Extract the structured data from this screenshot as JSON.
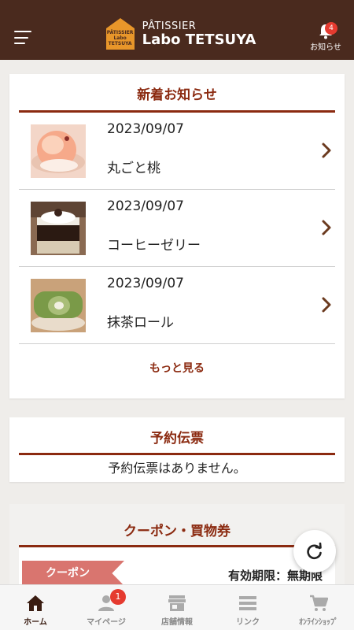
{
  "header": {
    "brand_small": "PÂTISSIER",
    "brand_main": "Labo TETSUYA",
    "logo_text": "PÂTISSIER Labo TETSUYA",
    "notifications_label": "お知らせ",
    "notifications_count": "4",
    "bg_color": "#4a2a1e"
  },
  "news": {
    "title": "新着お知らせ",
    "items": [
      {
        "date": "2023/09/07",
        "title": "丸ごと桃",
        "image": "peach-cake"
      },
      {
        "date": "2023/09/07",
        "title": "コーヒーゼリー",
        "image": "coffee-jelly"
      },
      {
        "date": "2023/09/07",
        "title": "抹茶ロール",
        "image": "matcha-roll"
      }
    ],
    "more_label": "もっと見る"
  },
  "reservation": {
    "title": "予約伝票",
    "empty_text": "予約伝票はありません。"
  },
  "coupons": {
    "title": "クーポン・買物券",
    "tag": "クーポン",
    "expiry": "有効期限：無期限"
  },
  "tabbar": {
    "items": [
      {
        "label": "ホーム",
        "icon": "home-icon",
        "active": true
      },
      {
        "label": "マイページ",
        "icon": "person-icon",
        "badge": "1"
      },
      {
        "label": "店舗情報",
        "icon": "store-icon"
      },
      {
        "label": "リンク",
        "icon": "list-icon"
      },
      {
        "label": "ｵﾝﾗｲﾝｼｮｯﾌﾟ",
        "icon": "cart-icon"
      }
    ]
  },
  "colors": {
    "accent": "#8b2a10",
    "badge": "#e53a2f",
    "coupon_tag": "#d9756f"
  }
}
